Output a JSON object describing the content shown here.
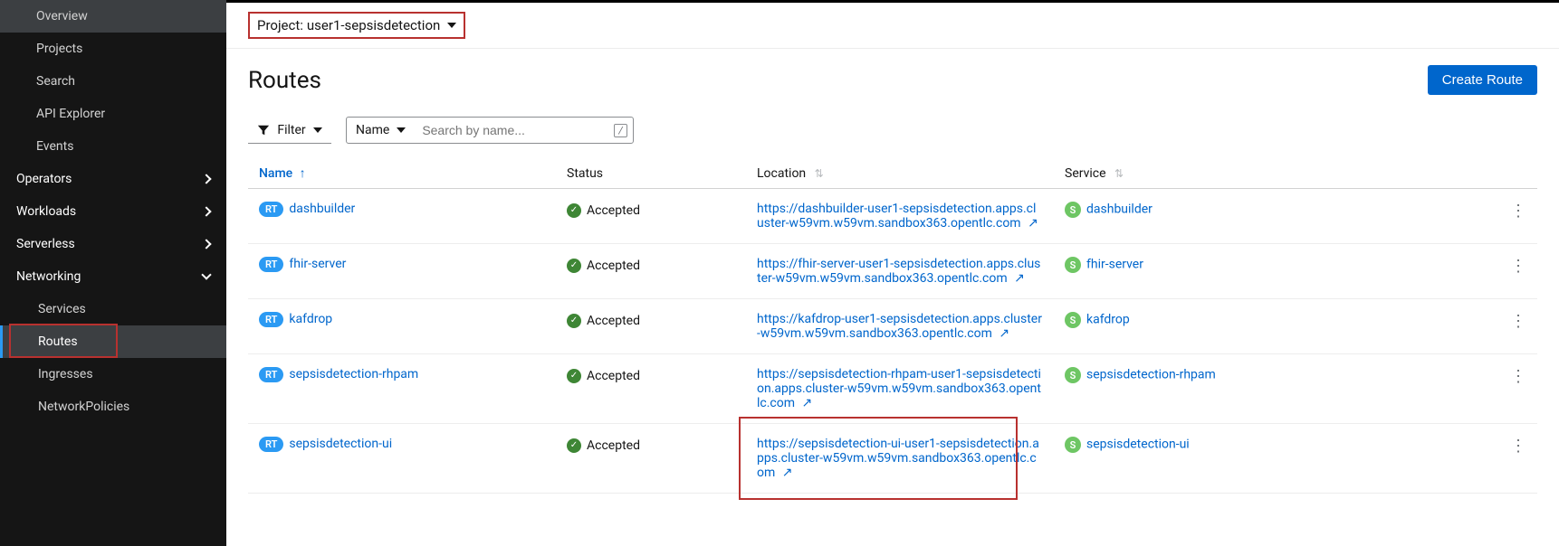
{
  "sidebar": {
    "top_items": [
      "Overview",
      "Projects",
      "Search",
      "API Explorer",
      "Events"
    ],
    "sections": [
      {
        "label": "Operators",
        "expanded": false
      },
      {
        "label": "Workloads",
        "expanded": false
      },
      {
        "label": "Serverless",
        "expanded": false
      },
      {
        "label": "Networking",
        "expanded": true,
        "children": [
          "Services",
          "Routes",
          "Ingresses",
          "NetworkPolicies"
        ],
        "selected": "Routes"
      }
    ]
  },
  "project_selector": {
    "prefix": "Project:",
    "name": "user1-sepsisdetection"
  },
  "page": {
    "title": "Routes",
    "create_button": "Create Route",
    "filter_label": "Filter",
    "name_filter_label": "Name",
    "search_placeholder": "Search by name...",
    "kbd_hint": "/"
  },
  "table": {
    "columns": [
      "Name",
      "Status",
      "Location",
      "Service"
    ],
    "sorted_column": "Name",
    "rows": [
      {
        "name": "dashbuilder",
        "status": "Accepted",
        "location": "https://dashbuilder-user1-sepsisdetection.apps.cluster-w59vm.w59vm.sandbox363.opentlc.com",
        "service": "dashbuilder"
      },
      {
        "name": "fhir-server",
        "status": "Accepted",
        "location": "https://fhir-server-user1-sepsisdetection.apps.cluster-w59vm.w59vm.sandbox363.opentlc.com",
        "service": "fhir-server"
      },
      {
        "name": "kafdrop",
        "status": "Accepted",
        "location": "https://kafdrop-user1-sepsisdetection.apps.cluster-w59vm.w59vm.sandbox363.opentlc.com",
        "service": "kafdrop"
      },
      {
        "name": "sepsisdetection-rhpam",
        "status": "Accepted",
        "location": "https://sepsisdetection-rhpam-user1-sepsisdetection.apps.cluster-w59vm.w59vm.sandbox363.opentlc.com",
        "service": "sepsisdetection-rhpam"
      },
      {
        "name": "sepsisdetection-ui",
        "status": "Accepted",
        "location": "https://sepsisdetection-ui-user1-sepsisdetection.apps.cluster-w59vm.w59vm.sandbox363.opentlc.com",
        "service": "sepsisdetection-ui",
        "highlight": true
      }
    ]
  },
  "badges": {
    "route": "RT",
    "service": "S"
  }
}
